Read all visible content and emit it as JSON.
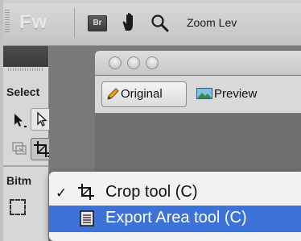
{
  "app": {
    "logo_text": "Fw",
    "bridge_label": "Br",
    "zoom_label": "Zoom Lev"
  },
  "tools": {
    "select_label": "Select",
    "bitmap_label": "Bitm"
  },
  "document": {
    "tabs": [
      {
        "label": "Original"
      },
      {
        "label": "Preview"
      }
    ]
  },
  "menu": {
    "items": [
      {
        "label": "Crop tool (C)",
        "checked": true,
        "icon": "crop-icon"
      },
      {
        "label": "Export Area tool (C)",
        "checked": false,
        "highlighted": true,
        "icon": "export-area-icon"
      }
    ],
    "check_glyph": "✓"
  },
  "colors": {
    "highlight": "#3d73d8",
    "panel": "#d7d7d7",
    "dark_bar": "#3a3a3a"
  }
}
